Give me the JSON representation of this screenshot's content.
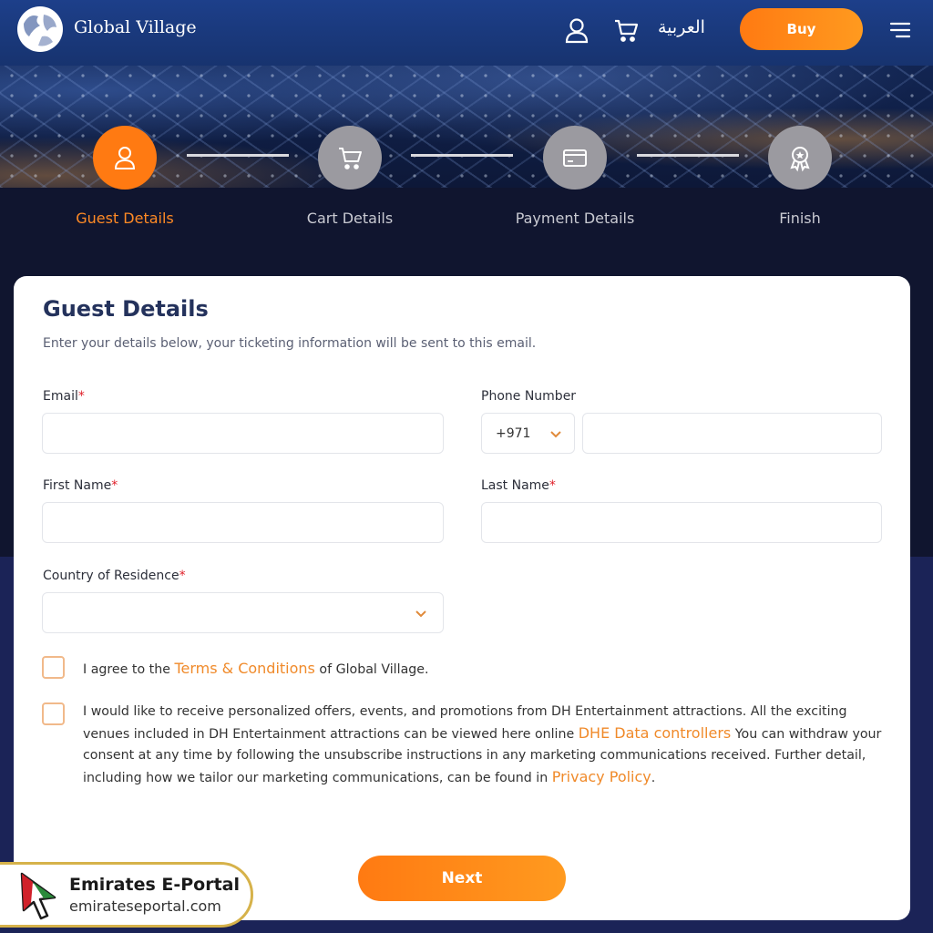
{
  "header": {
    "brand": "Global Village",
    "language_label": "العربية",
    "buy_label": "Buy"
  },
  "stepper": {
    "steps": [
      {
        "label": "Guest Details",
        "icon": "user-icon",
        "active": true
      },
      {
        "label": "Cart Details",
        "icon": "cart-icon",
        "active": false
      },
      {
        "label": "Payment Details",
        "icon": "credit-card-icon",
        "active": false
      },
      {
        "label": "Finish",
        "icon": "award-icon",
        "active": false
      }
    ]
  },
  "form": {
    "title": "Guest Details",
    "subtitle": "Enter your details below, your ticketing information will be sent to this email.",
    "email_label": "Email",
    "phone_label": "Phone Number",
    "phone_code": "+971",
    "first_name_label": "First Name",
    "last_name_label": "Last Name",
    "country_label": "Country of Residence",
    "required_mark": "*",
    "terms": {
      "prefix": "I agree to the ",
      "link": "Terms & Conditions",
      "suffix": " of Global Village."
    },
    "offers": {
      "text1": "I would like to receive personalized offers, events, and promotions from DH Entertainment attractions. All the exciting venues included in DH Entertainment attractions can be viewed here online ",
      "link1": "DHE Data controllers",
      "text2": " You can withdraw your consent at any time by following the unsubscribe instructions in any marketing communications received. Further detail, including how we tailor our marketing communications, can be found in ",
      "link2": "Privacy Policy",
      "text3": "."
    },
    "next_label": "Next"
  },
  "watermark": {
    "title": "Emirates E-Portal",
    "url": "emirateseportal.com"
  },
  "colors": {
    "accent": "#ff7a12",
    "header": "#1d3f8a",
    "title": "#24325c"
  }
}
